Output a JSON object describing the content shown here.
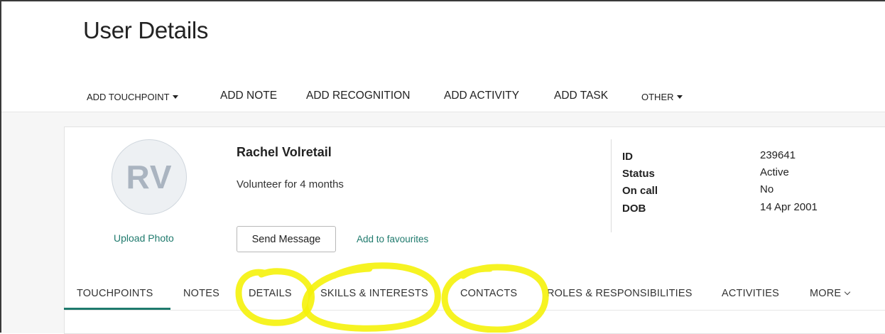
{
  "page": {
    "title": "User Details"
  },
  "actions": {
    "add_touchpoint": "ADD TOUCHPOINT",
    "add_note": "ADD NOTE",
    "add_recognition": "ADD RECOGNITION",
    "add_activity": "ADD ACTIVITY",
    "add_task": "ADD TASK",
    "other": "OTHER"
  },
  "profile": {
    "initials": "RV",
    "upload_photo": "Upload Photo",
    "name": "Rachel Volretail",
    "subtitle": "Volunteer for 4 months",
    "send_message": "Send Message",
    "add_to_favourites": "Add to favourites"
  },
  "info": {
    "rows": [
      {
        "label": "ID",
        "value": "239641"
      },
      {
        "label": "Status",
        "value": "Active"
      },
      {
        "label": "On call",
        "value": "No"
      },
      {
        "label": "DOB",
        "value": "14 Apr 2001"
      }
    ]
  },
  "tabs": {
    "items": [
      {
        "label": "TOUCHPOINTS"
      },
      {
        "label": "NOTES"
      },
      {
        "label": "DETAILS"
      },
      {
        "label": "SKILLS & INTERESTS"
      },
      {
        "label": "CONTACTS"
      },
      {
        "label": "ROLES & RESPONSIBILITIES"
      },
      {
        "label": "ACTIVITIES"
      },
      {
        "label": "MORE"
      }
    ],
    "active": "TOUCHPOINTS"
  },
  "colors": {
    "accent": "#1f7a6d",
    "highlight": "#f5f20a"
  },
  "icons": {
    "dropdown": "caret-down-icon",
    "more": "chevron-down-icon"
  }
}
